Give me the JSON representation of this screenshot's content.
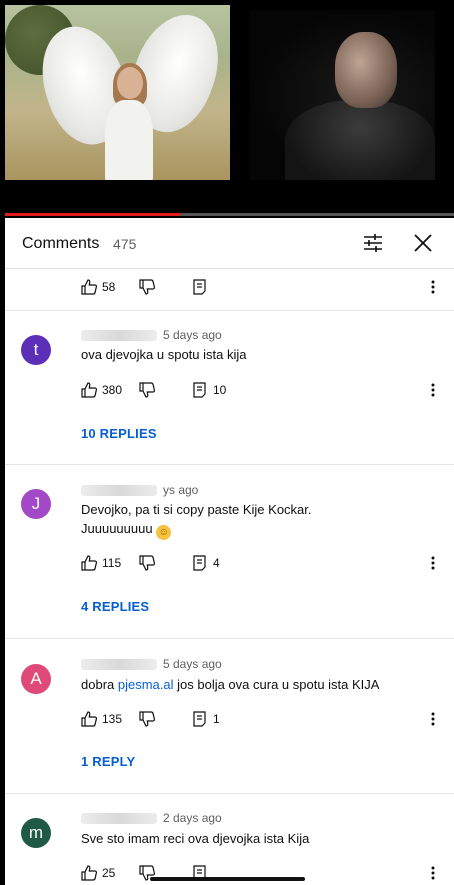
{
  "header": {
    "title": "Comments",
    "count": "475"
  },
  "top_actions": {
    "likes": "58"
  },
  "comments": [
    {
      "avatar_letter": "t",
      "avatar_color": "#5b2fb8",
      "age": "5 days ago",
      "text": "ova djevojka u spotu ista kija",
      "likes": "380",
      "replies_count": "10",
      "replies_label": "10 REPLIES"
    },
    {
      "avatar_letter": "J",
      "avatar_color": "#a348c6",
      "age": "ys ago",
      "text_line1": "Devojko, pa ti si copy paste Kije Kockar.",
      "text_line2": "Juuuuuuuuu",
      "emoji": "smiling-face",
      "likes": "115",
      "replies_count": "4",
      "replies_label": "4 REPLIES"
    },
    {
      "avatar_letter": "A",
      "avatar_color": "#e04a78",
      "age": "5 days ago",
      "text_before": "dobra ",
      "link_text": "pjesma.al",
      "text_after": " jos bolja ova cura u spotu ista KIJA",
      "likes": "135",
      "replies_count": "1",
      "replies_label": "1 REPLY"
    },
    {
      "avatar_letter": "m",
      "avatar_color": "#1f5a47",
      "age": "2 days ago",
      "text": "Sve sto imam reci ova djevojka ista Kija",
      "likes": "25"
    }
  ],
  "colors": {
    "link": "#065fd4",
    "progress": "#e31b1b"
  },
  "video": {
    "progress_fraction": 0.39
  }
}
